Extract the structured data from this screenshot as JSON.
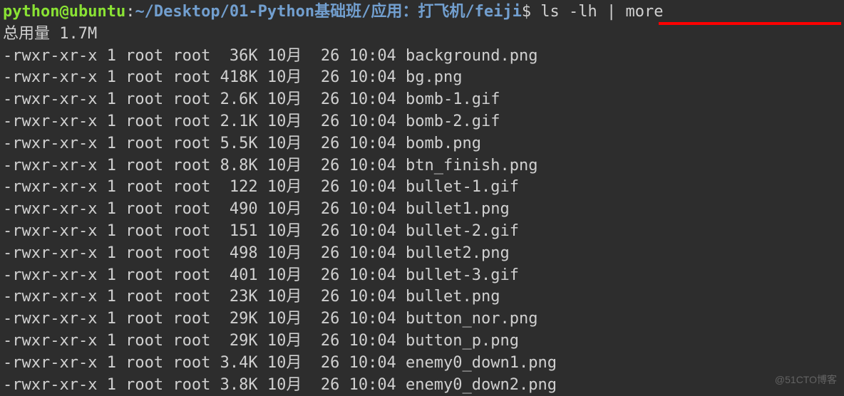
{
  "prompt": {
    "user_host": "python@ubuntu",
    "colon": ":",
    "path": "~/Desktop/01-Python基础班/应用：打飞机/feiji",
    "dollar": "$",
    "command": " ls -lh | more"
  },
  "total": "总用量 1.7M",
  "files": [
    {
      "perms": "-rwxr-xr-x",
      "links": "1",
      "owner": "root",
      "group": "root",
      "size": " 36K",
      "month": "10月",
      "day": " 26",
      "time": "10:04",
      "name": "background.png"
    },
    {
      "perms": "-rwxr-xr-x",
      "links": "1",
      "owner": "root",
      "group": "root",
      "size": "418K",
      "month": "10月",
      "day": " 26",
      "time": "10:04",
      "name": "bg.png"
    },
    {
      "perms": "-rwxr-xr-x",
      "links": "1",
      "owner": "root",
      "group": "root",
      "size": "2.6K",
      "month": "10月",
      "day": " 26",
      "time": "10:04",
      "name": "bomb-1.gif"
    },
    {
      "perms": "-rwxr-xr-x",
      "links": "1",
      "owner": "root",
      "group": "root",
      "size": "2.1K",
      "month": "10月",
      "day": " 26",
      "time": "10:04",
      "name": "bomb-2.gif"
    },
    {
      "perms": "-rwxr-xr-x",
      "links": "1",
      "owner": "root",
      "group": "root",
      "size": "5.5K",
      "month": "10月",
      "day": " 26",
      "time": "10:04",
      "name": "bomb.png"
    },
    {
      "perms": "-rwxr-xr-x",
      "links": "1",
      "owner": "root",
      "group": "root",
      "size": "8.8K",
      "month": "10月",
      "day": " 26",
      "time": "10:04",
      "name": "btn_finish.png"
    },
    {
      "perms": "-rwxr-xr-x",
      "links": "1",
      "owner": "root",
      "group": "root",
      "size": " 122",
      "month": "10月",
      "day": " 26",
      "time": "10:04",
      "name": "bullet-1.gif"
    },
    {
      "perms": "-rwxr-xr-x",
      "links": "1",
      "owner": "root",
      "group": "root",
      "size": " 490",
      "month": "10月",
      "day": " 26",
      "time": "10:04",
      "name": "bullet1.png"
    },
    {
      "perms": "-rwxr-xr-x",
      "links": "1",
      "owner": "root",
      "group": "root",
      "size": " 151",
      "month": "10月",
      "day": " 26",
      "time": "10:04",
      "name": "bullet-2.gif"
    },
    {
      "perms": "-rwxr-xr-x",
      "links": "1",
      "owner": "root",
      "group": "root",
      "size": " 498",
      "month": "10月",
      "day": " 26",
      "time": "10:04",
      "name": "bullet2.png"
    },
    {
      "perms": "-rwxr-xr-x",
      "links": "1",
      "owner": "root",
      "group": "root",
      "size": " 401",
      "month": "10月",
      "day": " 26",
      "time": "10:04",
      "name": "bullet-3.gif"
    },
    {
      "perms": "-rwxr-xr-x",
      "links": "1",
      "owner": "root",
      "group": "root",
      "size": " 23K",
      "month": "10月",
      "day": " 26",
      "time": "10:04",
      "name": "bullet.png"
    },
    {
      "perms": "-rwxr-xr-x",
      "links": "1",
      "owner": "root",
      "group": "root",
      "size": " 29K",
      "month": "10月",
      "day": " 26",
      "time": "10:04",
      "name": "button_nor.png"
    },
    {
      "perms": "-rwxr-xr-x",
      "links": "1",
      "owner": "root",
      "group": "root",
      "size": " 29K",
      "month": "10月",
      "day": " 26",
      "time": "10:04",
      "name": "button_p.png"
    },
    {
      "perms": "-rwxr-xr-x",
      "links": "1",
      "owner": "root",
      "group": "root",
      "size": "3.4K",
      "month": "10月",
      "day": " 26",
      "time": "10:04",
      "name": "enemy0_down1.png"
    },
    {
      "perms": "-rwxr-xr-x",
      "links": "1",
      "owner": "root",
      "group": "root",
      "size": "3.8K",
      "month": "10月",
      "day": " 26",
      "time": "10:04",
      "name": "enemy0_down2.png"
    }
  ],
  "watermark": "@51CTO博客"
}
